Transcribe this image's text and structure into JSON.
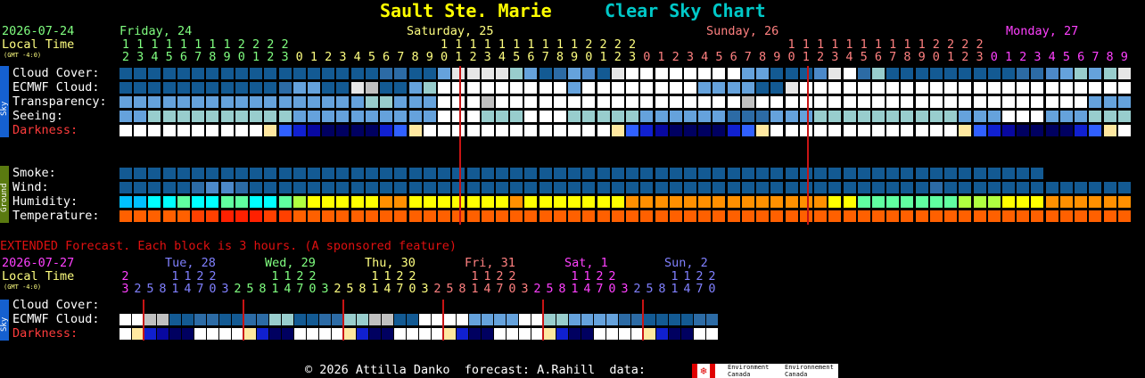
{
  "header": {
    "location": "Sault Ste. Marie",
    "title": "Clear Sky Chart",
    "location_color": "#ffff00",
    "title_color": "#00c8c8"
  },
  "main": {
    "date": "2026-07-24",
    "local_time_label": "Local Time",
    "gmt_offset": "(GMT -4:0)",
    "days": [
      {
        "label": "Friday, 24",
        "color": "#80ff80",
        "start_hour": 0
      },
      {
        "label": "Saturday, 25",
        "color": "#ffff80",
        "start_hour": 24
      },
      {
        "label": "Sunday, 26",
        "color": "#ff8080",
        "start_hour": 48
      },
      {
        "label": "Monday, 27",
        "color": "#ff40ff",
        "start_hour": 72
      }
    ],
    "sky_label": "Sky",
    "ground_label": "Ground",
    "rows": {
      "cloud": "Cloud Cover:",
      "ecmwf": "ECMWF Cloud:",
      "transparency": "Transparency:",
      "seeing": "Seeing:",
      "darkness": "Darkness:",
      "smoke": "Smoke:",
      "wind": "Wind:",
      "humidity": "Humidity:",
      "temperature": "Temperature:"
    }
  },
  "extended": {
    "note": "EXTENDED Forecast. Each block is 3 hours. (A sponsored feature)",
    "date": "2026-07-27",
    "local_time_label": "Local Time",
    "gmt_offset": "(GMT -4:0)",
    "days": [
      {
        "label": "Tue, 28",
        "color": "#8080ff"
      },
      {
        "label": "Wed, 29",
        "color": "#80ff80"
      },
      {
        "label": "Thu, 30",
        "color": "#ffff80"
      },
      {
        "label": "Fri, 31",
        "color": "#ff8080"
      },
      {
        "label": "Sat, 1",
        "color": "#ff40ff"
      },
      {
        "label": "Sun, 2",
        "color": "#8080ff"
      }
    ],
    "rows": {
      "cloud": "Cloud Cover:",
      "ecmwf": "ECMWF Cloud:",
      "darkness": "Darkness:"
    }
  },
  "footer": {
    "text": "© 2026 Attilla Danko  forecast: A.Rahill  data:",
    "logo_text_1": "Environment\nCanada",
    "logo_text_2": "Environnement\nCanada"
  },
  "colors": {
    "cloud_scale": [
      "#003f7f",
      "#135a93",
      "#2c6ba5",
      "#4c89c9",
      "#65a2dc",
      "#98cdcd",
      "#e6e6e6",
      "#ffffff",
      "#c0c0c0"
    ],
    "midnight_line": "#c81414",
    "label_white": "#ffffff",
    "label_darkness": "#ff3c3c",
    "date_color": "#80ff80",
    "local_time_color": "#ffff80",
    "sky_band": "#1560d0",
    "ground_band": "#5a7a10"
  },
  "chart_data": {
    "type": "heatmap",
    "title": "Clear Sky Chart",
    "location": "Sault Ste. Marie",
    "start_hour": 12,
    "hours": 87,
    "midnight_columns": [
      12,
      36,
      60
    ],
    "series": [
      {
        "name": "Cloud Cover",
        "values": [
          1,
          1,
          1,
          1,
          1,
          1,
          1,
          1,
          1,
          1,
          1,
          1,
          1,
          1,
          1,
          1,
          1,
          1,
          2,
          2,
          1,
          1,
          4,
          6,
          6,
          6,
          6,
          5,
          4,
          1,
          2,
          4,
          3,
          1,
          6,
          7,
          7,
          7,
          7,
          7,
          7,
          7,
          7,
          4,
          4,
          1,
          1,
          1,
          3,
          6,
          7,
          2,
          5,
          1,
          1,
          1,
          1,
          1,
          1,
          1,
          1,
          1,
          2,
          2,
          3,
          4,
          5,
          4,
          5,
          6,
          4,
          7,
          6,
          6,
          6,
          7,
          7,
          4,
          1,
          2,
          1,
          1,
          1,
          1,
          1,
          1,
          1,
          1
        ]
      },
      {
        "name": "ECMWF Cloud",
        "values": [
          1,
          1,
          1,
          1,
          1,
          1,
          1,
          1,
          1,
          1,
          1,
          2,
          4,
          4,
          1,
          1,
          6,
          8,
          1,
          1,
          4,
          5,
          7,
          7,
          7,
          7,
          7,
          7,
          7,
          7,
          7,
          4,
          7,
          7,
          7,
          7,
          7,
          7,
          7,
          7,
          4,
          4,
          4,
          4,
          1,
          1,
          6,
          7,
          7,
          7,
          7,
          7,
          7,
          7,
          7,
          7,
          7,
          7,
          7,
          7,
          7,
          7,
          7,
          7,
          7,
          7,
          7,
          7,
          7,
          7,
          7,
          6,
          7,
          6,
          1,
          1,
          1,
          3,
          4,
          4,
          4,
          4,
          4,
          4,
          7,
          7,
          7,
          7
        ]
      },
      {
        "name": "Transparency",
        "values": [
          4,
          4,
          4,
          4,
          4,
          4,
          4,
          4,
          4,
          4,
          4,
          4,
          4,
          4,
          4,
          4,
          4,
          5,
          5,
          4,
          4,
          4,
          7,
          7,
          7,
          8,
          7,
          7,
          7,
          7,
          7,
          7,
          7,
          7,
          7,
          7,
          7,
          7,
          7,
          7,
          7,
          7,
          7,
          8,
          7,
          7,
          7,
          7,
          7,
          7,
          7,
          7,
          7,
          7,
          7,
          7,
          7,
          7,
          7,
          7,
          7,
          7,
          7,
          7,
          7,
          7,
          7,
          4,
          4,
          4,
          4,
          4,
          4,
          4,
          4,
          4,
          4,
          4,
          4,
          4,
          4,
          4,
          4,
          4,
          4,
          4,
          4,
          4
        ]
      },
      {
        "name": "Seeing",
        "values": [
          4,
          4,
          5,
          5,
          5,
          5,
          5,
          5,
          5,
          5,
          5,
          5,
          4,
          4,
          4,
          4,
          4,
          4,
          4,
          4,
          4,
          4,
          7,
          7,
          7,
          5,
          5,
          5,
          7,
          7,
          7,
          5,
          5,
          5,
          5,
          5,
          4,
          4,
          4,
          4,
          4,
          4,
          2,
          2,
          2,
          4,
          4,
          4,
          5,
          5,
          5,
          5,
          5,
          5,
          5,
          5,
          5,
          5,
          4,
          4,
          4,
          7,
          7,
          7,
          4,
          4,
          4,
          5,
          5,
          5,
          8,
          8,
          8,
          4,
          4,
          4,
          8,
          8,
          8,
          8,
          8,
          8,
          8,
          8,
          8,
          8,
          8,
          8
        ]
      },
      {
        "name": "Darkness",
        "values": [
          0,
          0,
          0,
          0,
          0,
          0,
          0,
          0,
          0,
          0,
          1,
          2,
          3,
          4,
          5,
          5,
          5,
          5,
          3,
          2,
          1,
          0,
          0,
          0,
          0,
          0,
          0,
          0,
          0,
          0,
          0,
          0,
          0,
          0,
          1,
          2,
          3,
          4,
          5,
          5,
          5,
          5,
          3,
          2,
          1,
          0,
          0,
          0,
          0,
          0,
          0,
          0,
          0,
          0,
          0,
          0,
          0,
          0,
          1,
          2,
          3,
          4,
          5,
          5,
          5,
          5,
          3,
          2,
          1,
          0,
          0,
          0,
          0,
          0,
          0,
          0,
          0,
          0,
          0,
          0,
          0,
          1,
          2,
          3,
          4,
          5,
          5,
          5
        ]
      },
      {
        "name": "Smoke",
        "values": [
          1,
          1,
          1,
          1,
          1,
          1,
          1,
          1,
          1,
          1,
          1,
          1,
          1,
          1,
          1,
          1,
          1,
          1,
          1,
          1,
          1,
          1,
          1,
          1,
          1,
          1,
          1,
          1,
          1,
          1,
          1,
          1,
          1,
          1,
          1,
          1,
          1,
          1,
          1,
          1,
          1,
          1,
          1,
          1,
          1,
          1,
          1,
          1,
          1,
          1,
          1,
          1,
          1,
          1,
          1,
          1,
          1,
          1,
          1,
          1,
          1,
          1,
          1,
          1
        ]
      },
      {
        "name": "Wind",
        "values": [
          1,
          1,
          1,
          1,
          1,
          2,
          3,
          3,
          2,
          1,
          1,
          1,
          1,
          1,
          1,
          1,
          1,
          1,
          1,
          1,
          1,
          1,
          1,
          1,
          1,
          1,
          1,
          1,
          1,
          1,
          1,
          1,
          1,
          1,
          1,
          1,
          1,
          1,
          1,
          1,
          1,
          1,
          1,
          1,
          1,
          1,
          1,
          1,
          1,
          1,
          1,
          1,
          1,
          1,
          1,
          1,
          2,
          1,
          1,
          1,
          1,
          1,
          1,
          1,
          1,
          1,
          1,
          1,
          1,
          1,
          1,
          1,
          1,
          1,
          1,
          1,
          1,
          1,
          1,
          1,
          1,
          1,
          1,
          1,
          1,
          1,
          1,
          1
        ]
      },
      {
        "name": "Humidity",
        "values": [
          2,
          2,
          3,
          3,
          4,
          3,
          3,
          4,
          4,
          3,
          3,
          4,
          5,
          6,
          6,
          6,
          6,
          6,
          7,
          7,
          6,
          6,
          6,
          6,
          6,
          6,
          6,
          7,
          6,
          6,
          6,
          6,
          6,
          6,
          6,
          7,
          7,
          7,
          7,
          7,
          7,
          7,
          7,
          7,
          7,
          7,
          7,
          7,
          7,
          6,
          6,
          4,
          4,
          4,
          4,
          4,
          4,
          4,
          5,
          5,
          5,
          6,
          6,
          6,
          7,
          7,
          7,
          7,
          7,
          7,
          7,
          7,
          7,
          7,
          7,
          7,
          7,
          7,
          7,
          6,
          6,
          4,
          4,
          4,
          4,
          4,
          4,
          4
        ]
      },
      {
        "name": "Temperature",
        "values": [
          4,
          4,
          4,
          4,
          4,
          5,
          5,
          6,
          6,
          6,
          5,
          5,
          4,
          4,
          4,
          4,
          4,
          4,
          4,
          4,
          4,
          4,
          4,
          4,
          4,
          4,
          4,
          4,
          4,
          4,
          4,
          4,
          4,
          4,
          4,
          4,
          4,
          4,
          4,
          4,
          4,
          4,
          4,
          4,
          4,
          4,
          4,
          4,
          4,
          4,
          4,
          4,
          4,
          4,
          4,
          4,
          4,
          4,
          4,
          4,
          4,
          4,
          4,
          4,
          4,
          4,
          4,
          4,
          4,
          4,
          4,
          4,
          4,
          4,
          4,
          4,
          4,
          4,
          4,
          4,
          4,
          4,
          4,
          4,
          4,
          4,
          4,
          4
        ]
      }
    ],
    "extended": {
      "block_hours": 3,
      "start_hour": 3,
      "hour_labels": [
        "3",
        "2",
        "5",
        "8",
        "1",
        "4",
        "7",
        "0",
        "3",
        "2",
        "5",
        "8",
        "1",
        "4",
        "7",
        "0",
        "3",
        "2",
        "5",
        "8",
        "1",
        "4",
        "7",
        "0",
        "3",
        "2",
        "5",
        "8",
        "1",
        "4",
        "7",
        "0",
        "3",
        "2",
        "5",
        "8",
        "1",
        "4",
        "7",
        "0",
        "3",
        "2",
        "5",
        "8",
        "1",
        "4",
        "7",
        "0"
      ],
      "midnight_columns": [
        1,
        9,
        17,
        25,
        33,
        41
      ],
      "series": [
        {
          "name": "Cloud Cover",
          "values": [
            7,
            7,
            8,
            8,
            1,
            1,
            2,
            2,
            1,
            1,
            2,
            2,
            5,
            5,
            1,
            1,
            2,
            2,
            5,
            5,
            8,
            8,
            1,
            1,
            7,
            7,
            7,
            7,
            4,
            4,
            4,
            4,
            7,
            7,
            5,
            5,
            4,
            4,
            4,
            4,
            2,
            2,
            1,
            1,
            1,
            1,
            2,
            2
          ]
        },
        {
          "name": "Darkness",
          "values": [
            0,
            1,
            3,
            4,
            5,
            5,
            0,
            0,
            0,
            0,
            1,
            3,
            5,
            5,
            0,
            0,
            0,
            0,
            1,
            3,
            5,
            5,
            0,
            0,
            0,
            0,
            1,
            3,
            5,
            5,
            0,
            0,
            0,
            0,
            1,
            3,
            5,
            5,
            0,
            0,
            0,
            0,
            1,
            3,
            5,
            5,
            0,
            0
          ]
        }
      ]
    }
  }
}
